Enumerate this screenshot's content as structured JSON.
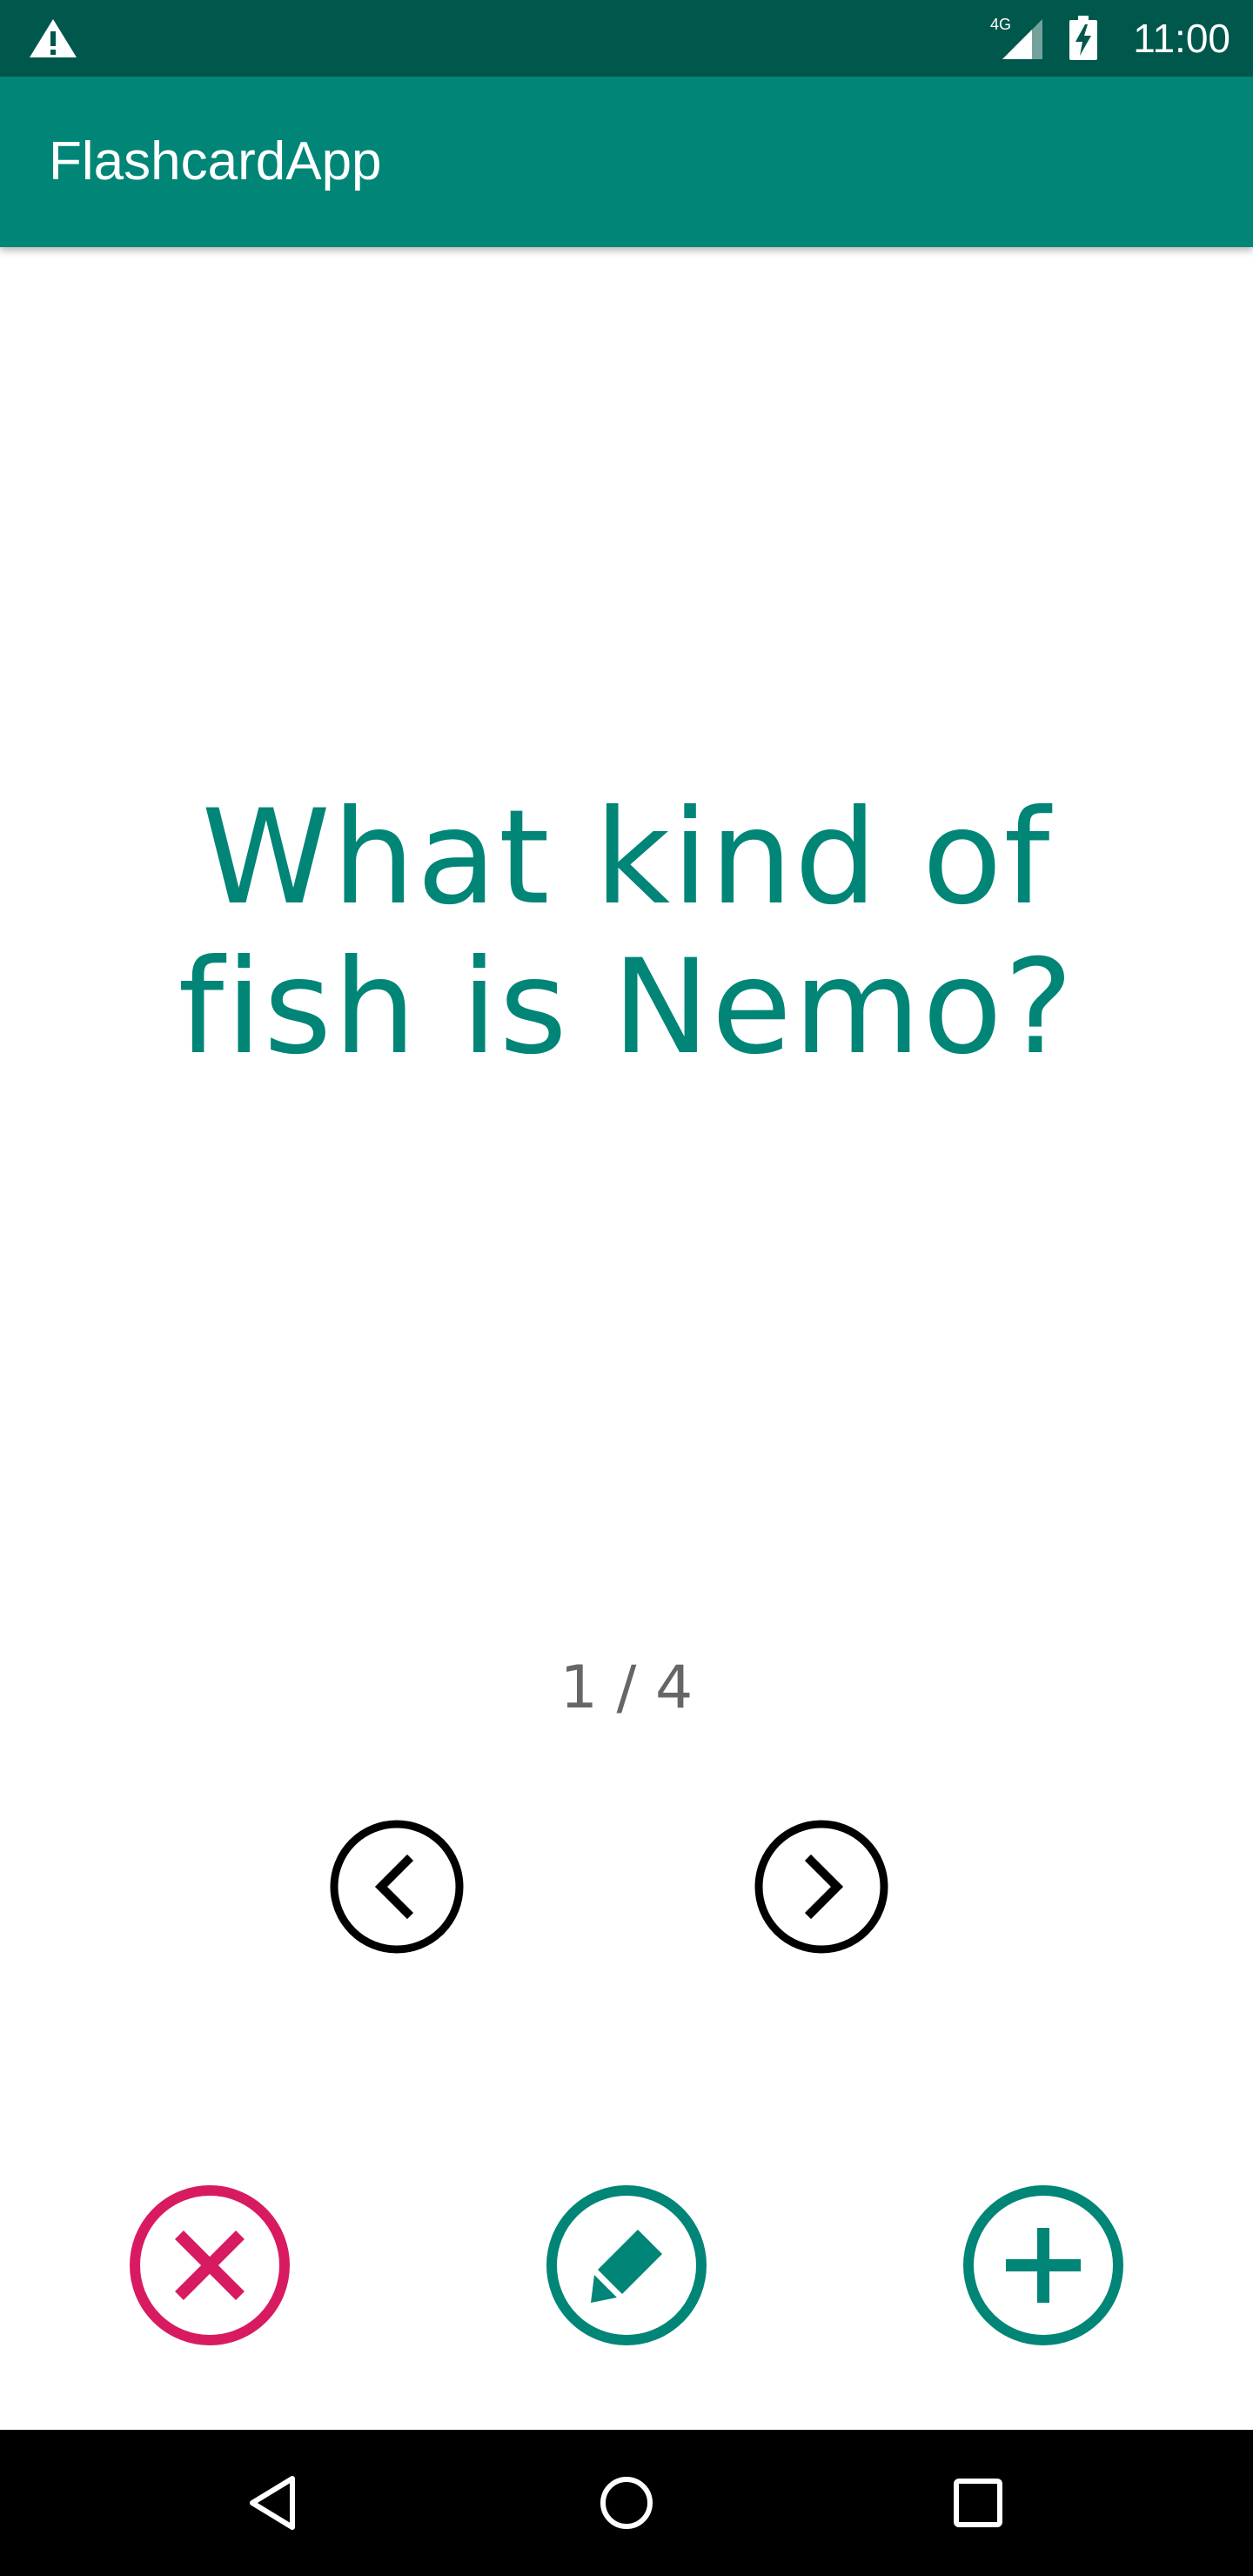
{
  "status_bar": {
    "network_label": "4G",
    "time": "11:00",
    "icons": [
      "warning-icon",
      "signal-icon",
      "battery-icon"
    ],
    "background": "#00574b"
  },
  "app_bar": {
    "title": "FlashcardApp",
    "background": "#008577"
  },
  "card": {
    "question": "What kind of fish is Nemo?",
    "text_color": "#008577"
  },
  "pager": {
    "label": "1 / 4",
    "prev_icon": "chevron-left-icon",
    "next_icon": "chevron-right-icon"
  },
  "actions": [
    {
      "name": "delete",
      "icon": "close-icon",
      "color": "#d81b60"
    },
    {
      "name": "edit",
      "icon": "pencil-icon",
      "color": "#008577"
    },
    {
      "name": "add",
      "icon": "plus-icon",
      "color": "#008577"
    }
  ],
  "system_nav": {
    "icons": [
      "back-icon",
      "home-icon",
      "recents-icon"
    ]
  }
}
